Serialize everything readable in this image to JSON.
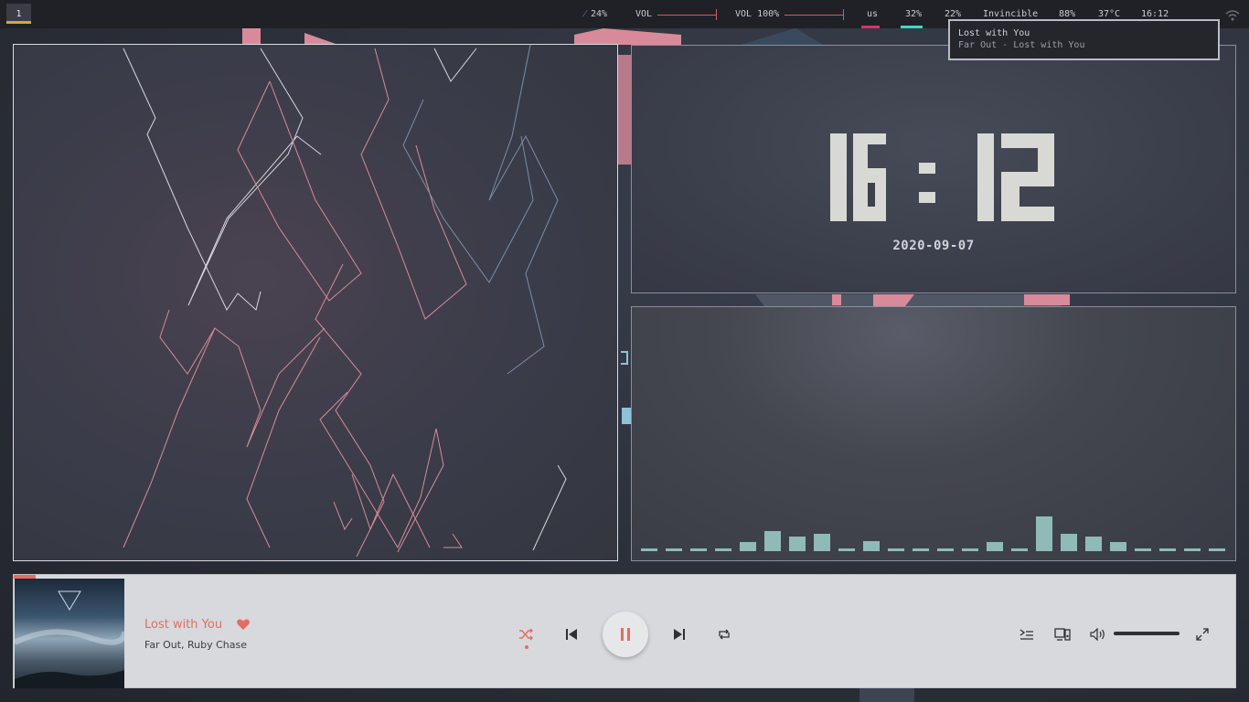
{
  "topbar": {
    "workspace": "1",
    "cpu_label": "24%",
    "vol1_label": "VOL",
    "vol2_label": "VOL 100%",
    "keyboard_layout": "us",
    "item_32": "32%",
    "item_22": "22%",
    "track_label": "Invincible",
    "item_88": "88%",
    "temperature": "37°C",
    "time": "16:12",
    "accent_colors": {
      "workspace": "#e0a23a",
      "layout": "#d6336c",
      "mem": "#3fd6c4",
      "volume": "#d45a5f"
    }
  },
  "notification": {
    "title": "Lost with You",
    "body": "Far Out - Lost with You"
  },
  "clock": {
    "time": "16: 12",
    "date": "2020-09-07"
  },
  "spectrum": {
    "bars": [
      0.05,
      0.05,
      0.05,
      0.05,
      0.16,
      0.37,
      0.26,
      0.31,
      0.05,
      0.18,
      0.05,
      0.05,
      0.05,
      0.05,
      0.16,
      0.05,
      0.63,
      0.32,
      0.26,
      0.16,
      0.05,
      0.05,
      0.05,
      0.05
    ],
    "color": "#8fbab8"
  },
  "player": {
    "title": "Far Out - Lost with You",
    "track_title": "Lost with You",
    "artists": "Far Out, Ruby Chase",
    "accent": "#e26d62",
    "volume_level": 1.0,
    "controls": [
      "shuffle-icon",
      "previous-icon",
      "pause-icon",
      "next-icon",
      "repeat-icon",
      "queue-icon",
      "devices-icon",
      "volume-icon",
      "fullscreen-icon"
    ]
  }
}
